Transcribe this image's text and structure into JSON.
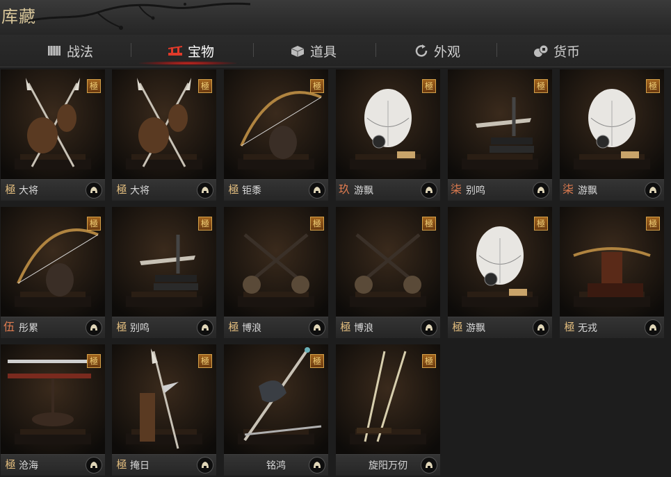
{
  "header": {
    "title": "库藏"
  },
  "tabs": [
    {
      "label": "战法",
      "icon": "scroll-icon"
    },
    {
      "label": "宝物",
      "icon": "shrine-icon",
      "active": true
    },
    {
      "label": "道具",
      "icon": "box-icon"
    },
    {
      "label": "外观",
      "icon": "refresh-icon"
    },
    {
      "label": "货币",
      "icon": "coins-icon"
    }
  ],
  "items": [
    {
      "grade": "極",
      "name": "大将",
      "art": "crossed-spears"
    },
    {
      "grade": "極",
      "name": "大将",
      "art": "crossed-spears"
    },
    {
      "grade": "極",
      "name": "钜黍",
      "art": "bow"
    },
    {
      "grade": "玖",
      "name": "游飘",
      "art": "feather-fan"
    },
    {
      "grade": "柒",
      "name": "别鸣",
      "art": "short-sword"
    },
    {
      "grade": "柒",
      "name": "游飘",
      "art": "feather-fan"
    },
    {
      "grade": "伍",
      "name": "彤累",
      "art": "longbow"
    },
    {
      "grade": "極",
      "name": "别鸣",
      "art": "short-sword"
    },
    {
      "grade": "極",
      "name": "博浪",
      "art": "maces"
    },
    {
      "grade": "極",
      "name": "博浪",
      "art": "maces"
    },
    {
      "grade": "極",
      "name": "游飘",
      "art": "feather-fan"
    },
    {
      "grade": "極",
      "name": "无戎",
      "art": "crossbow"
    },
    {
      "grade": "極",
      "name": "沧海",
      "art": "sword-rack"
    },
    {
      "grade": "極",
      "name": "掩日",
      "art": "halberd"
    },
    {
      "grade": "",
      "name": "铭鸿",
      "art": "dragon-sword"
    },
    {
      "grade": "",
      "name": "旋阳万仞",
      "art": "twin-swords"
    }
  ],
  "badge_label": "極",
  "colors": {
    "title_gold": "#d8c69a",
    "grade_gold": "#e6c080",
    "grade_orange": "#e07c50",
    "active_tab_glow": "#dc281e"
  }
}
